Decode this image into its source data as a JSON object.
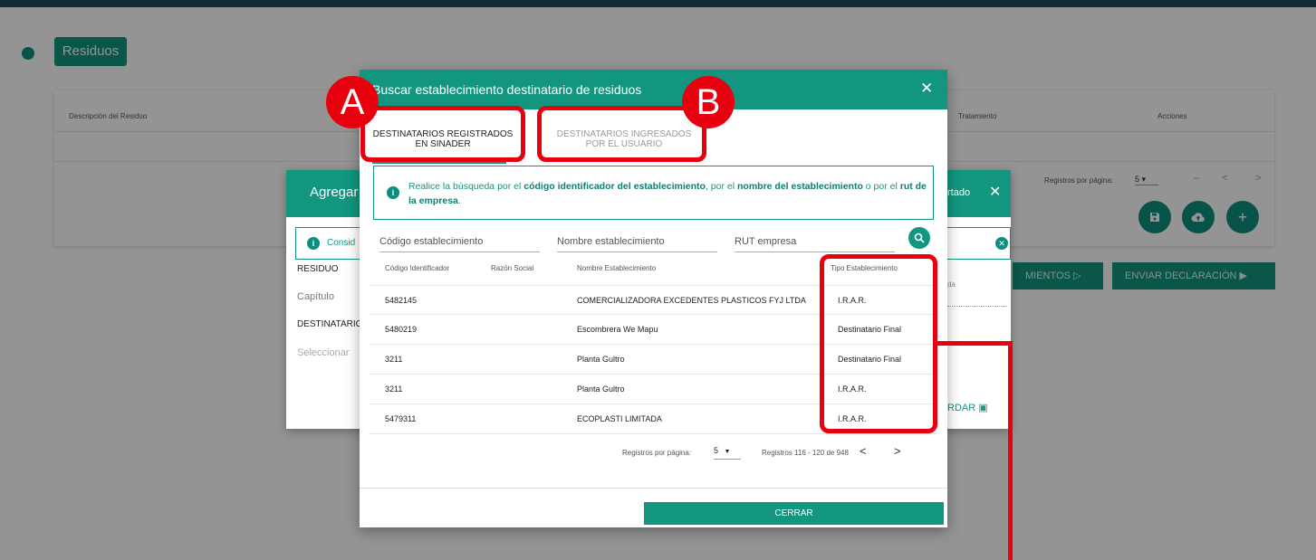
{
  "background": {
    "section_label": "Residuos",
    "table_headers": {
      "descripcion": "Descripción del Residuo",
      "tratamiento": "Tratamiento",
      "acciones": "Acciones"
    },
    "pager_label": "Registros por página:",
    "pager_value": "5",
    "pager_dash": "–",
    "prev": "<",
    "next": ">",
    "btn_movimientos": "MIENTOS",
    "btn_enviar": "ENVIAR DECLARACIÓN"
  },
  "mid_dialog": {
    "title": "Agregar",
    "right_title": "rtado",
    "info_text": "Consid",
    "label_residuo": "RESIDUO",
    "input_capitulo": "Capítulo",
    "label_destinatario": "DESTINATARIO",
    "input_seleccionar": "Seleccionar",
    "right_small": "da",
    "save_label": "RDAR"
  },
  "dialog": {
    "title": "Buscar establecimiento destinatario de residuos",
    "close": "✕",
    "tabs": [
      {
        "line1": "DESTINATARIOS REGISTRADOS",
        "line2": "EN SINADER"
      },
      {
        "line1": "DESTINATARIOS INGRESADOS",
        "line2": "POR EL USUARIO"
      }
    ],
    "info": {
      "p1": "Realice la búsqueda por el ",
      "b1": "código identificador del establecimiento",
      "p2": ", por el ",
      "b2": "nombre del establecimiento",
      "p3": " o por el ",
      "b3": "rut de la empresa",
      "p4": "."
    },
    "search": {
      "codigo_placeholder": "Código establecimiento",
      "nombre_placeholder": "Nombre establecimiento",
      "rut_placeholder": "RUT empresa"
    },
    "table": {
      "headers": [
        "Código Identificador",
        "Razón Social",
        "Nombre Establecimiento",
        "Tipo Establecimiento"
      ],
      "rows": [
        {
          "codigo": "5482145",
          "razon": "",
          "nombre": "COMERCIALIZADORA EXCEDENTES PLASTICOS FYJ LTDA",
          "tipo": "I.R.A.R."
        },
        {
          "codigo": "5480219",
          "razon": "",
          "nombre": "Escombrera We Mapu",
          "tipo": "Destinatario Final"
        },
        {
          "codigo": "3211",
          "razon": "",
          "nombre": "Planta Gultro",
          "tipo": "Destinatario Final"
        },
        {
          "codigo": "3211",
          "razon": "",
          "nombre": "Planta Gultro",
          "tipo": "I.R.A.R."
        },
        {
          "codigo": "5479311",
          "razon": "",
          "nombre": "ECOPLASTI LIMITADA",
          "tipo": "I.R.A.R."
        }
      ]
    },
    "pager": {
      "label": "Registros por página:",
      "value": "5",
      "range": "Registros 116 - 120 de 948",
      "prev": "<",
      "next": ">"
    },
    "close_button": "CERRAR"
  },
  "annotations": {
    "a": "A",
    "b": "B",
    "color": "#e8000f"
  },
  "colors": {
    "accent": "#12967f",
    "header_dark": "#1d4f5a"
  }
}
